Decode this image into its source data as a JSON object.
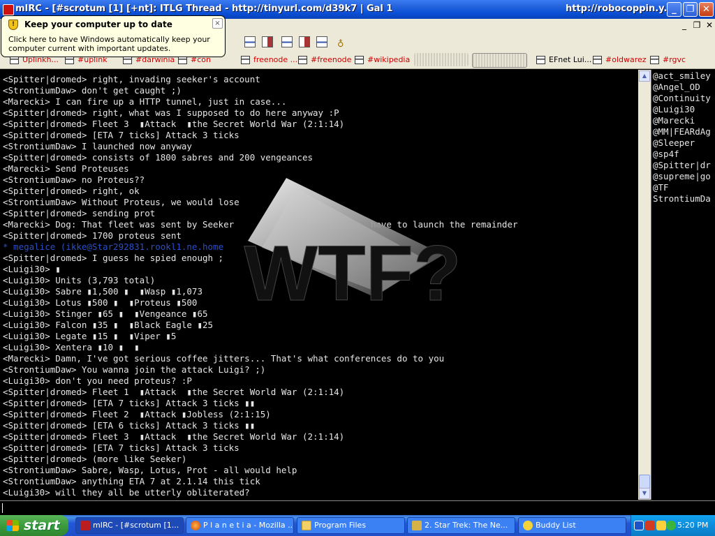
{
  "window": {
    "title": "mIRC - [#scrotum [1] [+nt]: ITLG Thread - http://tinyurl.com/d39k7 | Gal 1",
    "title_right": "http://robocoppin.y..."
  },
  "balloon": {
    "title": "Keep your computer up to date",
    "body": "Click here to have Windows automatically keep your computer current with important updates.",
    "close": "×"
  },
  "switchbar": {
    "items": [
      "Uplinkh...",
      "#uplink",
      "#darwinia",
      "#con",
      "freenode ...",
      "#freenode",
      "#wikipedia",
      "EFnet Lui...",
      "#oldwarez",
      "#rgvc"
    ]
  },
  "chat": {
    "lines": [
      {
        "text": "<Spitter|dromed> right, invading seeker's account",
        "kind": "msg"
      },
      {
        "text": "<StrontiumDaw> don't get caught ;)",
        "kind": "msg"
      },
      {
        "text": "<Marecki> I can fire up a HTTP tunnel, just in case...",
        "kind": "msg"
      },
      {
        "text": "<Spitter|dromed> right, what was I supposed to do here anyway :P",
        "kind": "msg"
      },
      {
        "text": "<Spitter|dromed> Fleet 3  ▮Attack  ▮the Secret World War (2:1:14)",
        "kind": "msg"
      },
      {
        "text": "<Spitter|dromed> [ETA 7 ticks] Attack 3 ticks",
        "kind": "msg"
      },
      {
        "text": "<StrontiumDaw> I launched now anyway",
        "kind": "msg"
      },
      {
        "text": "<Spitter|dromed> consists of 1800 sabres and 200 vengeances",
        "kind": "msg"
      },
      {
        "text": "<Marecki> Send Proteuses",
        "kind": "msg"
      },
      {
        "text": "<StrontiumDaw> no Proteus??",
        "kind": "msg"
      },
      {
        "text": "<Spitter|dromed> right, ok",
        "kind": "msg"
      },
      {
        "text": "<StrontiumDaw> Without Proteus, we would lose",
        "kind": "msg"
      },
      {
        "text": "<Spitter|dromed> sending prot",
        "kind": "msg"
      },
      {
        "text": "<Marecki> Dog: That fleet was sent by Seeker                          have to launch the remainder",
        "kind": "msg"
      },
      {
        "text": "<Spitter|dromed> 1700 proteus sent",
        "kind": "msg"
      },
      {
        "text": "* megalice (ikke@Star292831.rookl1.ne.home                    ",
        "kind": "join"
      },
      {
        "text": "<Spitter|dromed> I guess he spied enough ;",
        "kind": "msg"
      },
      {
        "text": "<Luigi30> ▮",
        "kind": "msg"
      },
      {
        "text": "<Luigi30> Units (3,793 total)",
        "kind": "msg"
      },
      {
        "text": "<Luigi30> Sabre ▮1,500 ▮  ▮Wasp ▮1,073",
        "kind": "msg"
      },
      {
        "text": "<Luigi30> Lotus ▮500 ▮  ▮Proteus ▮500",
        "kind": "msg"
      },
      {
        "text": "<Luigi30> Stinger ▮65 ▮  ▮Vengeance ▮65",
        "kind": "msg"
      },
      {
        "text": "<Luigi30> Falcon ▮35 ▮  ▮Black Eagle ▮25",
        "kind": "msg"
      },
      {
        "text": "<Luigi30> Legate ▮15 ▮  ▮Viper ▮5",
        "kind": "msg"
      },
      {
        "text": "<Luigi30> Xentera ▮10 ▮  ▮",
        "kind": "msg"
      },
      {
        "text": "<Marecki> Damn, I've got serious coffee jitters... That's what conferences do to you",
        "kind": "msg"
      },
      {
        "text": "<StrontiumDaw> You wanna join the attack Luigi? ;)",
        "kind": "msg"
      },
      {
        "text": "<Luigi30> don't you need proteus? :P",
        "kind": "msg"
      },
      {
        "text": "<Spitter|dromed> Fleet 1  ▮Attack  ▮the Secret World War (2:1:14)",
        "kind": "msg"
      },
      {
        "text": "<Spitter|dromed> [ETA 7 ticks] Attack 3 ticks ▮▮",
        "kind": "msg"
      },
      {
        "text": "<Spitter|dromed> Fleet 2  ▮Attack ▮Jobless (2:1:15)",
        "kind": "msg"
      },
      {
        "text": "<Spitter|dromed> [ETA 6 ticks] Attack 3 ticks ▮▮",
        "kind": "msg"
      },
      {
        "text": "<Spitter|dromed> Fleet 3  ▮Attack  ▮the Secret World War (2:1:14)",
        "kind": "msg"
      },
      {
        "text": "<Spitter|dromed> [ETA 7 ticks] Attack 3 ticks",
        "kind": "msg"
      },
      {
        "text": "<Spitter|dromed> (more like Seeker)",
        "kind": "msg"
      },
      {
        "text": "<StrontiumDaw> Sabre, Wasp, Lotus, Prot - all would help",
        "kind": "msg"
      },
      {
        "text": "<StrontiumDaw> anything ETA 7 at 2.1.14 this tick",
        "kind": "msg"
      },
      {
        "text": "<Luigi30> will they all be utterly obliterated?",
        "kind": "msg"
      }
    ],
    "overlay_text": "WTF?"
  },
  "nicklist": [
    "@act_smiley",
    "@Angel_OD",
    "@Continuity",
    "@Luigi30",
    "@Marecki",
    "@MM|FEARdAg",
    "@Sleeper",
    "@sp4f",
    "@Spitter|dr",
    "@supreme|go",
    "@TF",
    "StrontiumDa"
  ],
  "taskbar": {
    "start": "start",
    "tasks": [
      "mIRC - [#scrotum [1...",
      "P l a n e t i a - Mozilla ...",
      "Program Files",
      "2. Star Trek: The Ne...",
      "Buddy List"
    ],
    "clock": "5:20 PM"
  },
  "colors": {
    "titlebar": "#0a4fd6",
    "chat_bg": "#000000",
    "chat_text": "#e6e6e6",
    "join_text": "#2a4fc9",
    "switchbar_text": "#cc0000",
    "balloon_bg": "#ffffe1"
  },
  "icons": [
    "app-icon",
    "minimize-icon",
    "maximize-icon",
    "close-icon",
    "shield-icon",
    "channel-icon",
    "scroll-up-icon",
    "scroll-down-icon",
    "start-flag-icon",
    "firefox-icon",
    "folder-icon",
    "trek-icon",
    "buddy-icon",
    "tray-icon"
  ]
}
